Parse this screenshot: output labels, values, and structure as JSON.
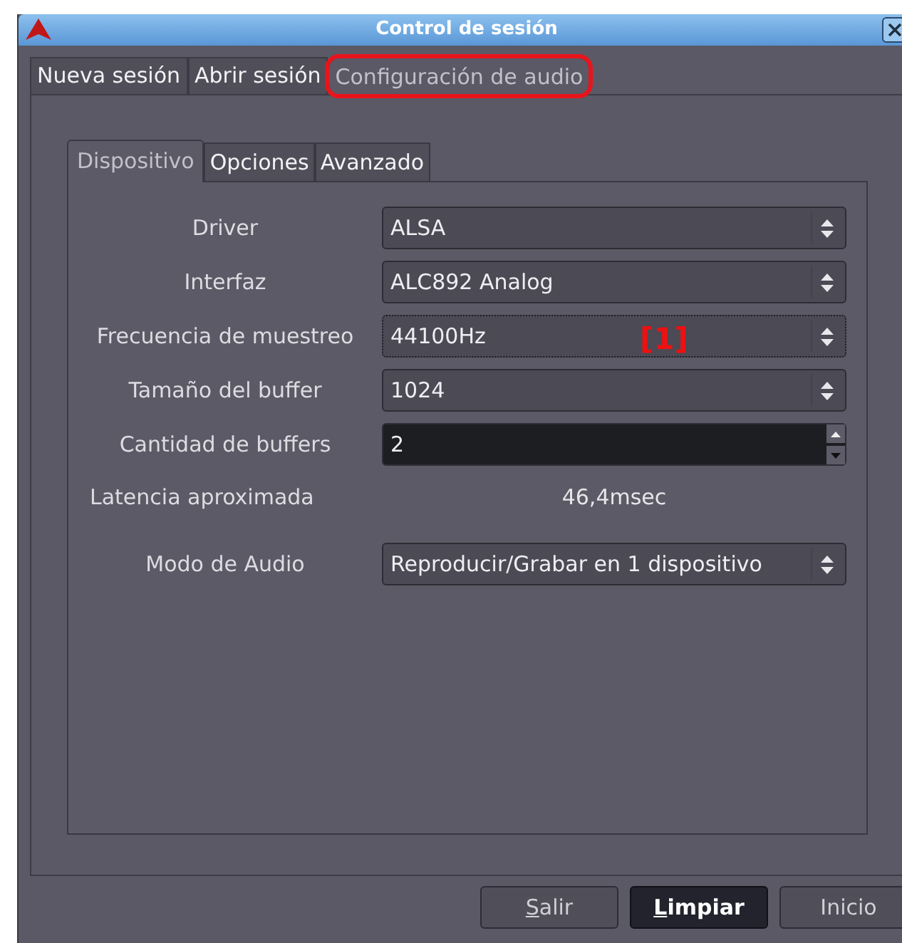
{
  "window": {
    "title": "Control de sesión"
  },
  "tabs": [
    {
      "label": "Nueva sesión",
      "selected": false,
      "highlighted": false
    },
    {
      "label": "Abrir sesión",
      "selected": false,
      "highlighted": false
    },
    {
      "label": "Configuración de audio",
      "selected": true,
      "highlighted": true
    }
  ],
  "subtabs": [
    {
      "label": "Dispositivo",
      "selected": true
    },
    {
      "label": "Opciones",
      "selected": false
    },
    {
      "label": "Avanzado",
      "selected": false
    }
  ],
  "rows": [
    {
      "kind": "combo",
      "label": "Driver",
      "value": "ALSA",
      "focused": false
    },
    {
      "kind": "combo",
      "label": "Interfaz",
      "value": "ALC892 Analog",
      "focused": false
    },
    {
      "kind": "combo",
      "label": "Frecuencia de muestreo",
      "value": "44100Hz",
      "focused": true,
      "marker": "[1]"
    },
    {
      "kind": "combo",
      "label": "Tamaño del buffer",
      "value": "1024",
      "focused": false
    },
    {
      "kind": "spin",
      "label": "Cantidad de buffers",
      "value": "2",
      "focused": false
    },
    {
      "kind": "readout",
      "label": "Latencia aproximada",
      "value": "46,4msec"
    },
    {
      "kind": "combo",
      "label": "Modo de Audio",
      "value": "Reproducir/Grabar en 1 dispositivo",
      "focused": false
    }
  ],
  "buttons": [
    {
      "label": "Salir",
      "default": false,
      "accelerator_underlined": true
    },
    {
      "label": "Limpiar",
      "default": true,
      "accelerator_underlined": true
    },
    {
      "label": "Inicio",
      "default": false,
      "accelerator_underlined": false
    }
  ]
}
